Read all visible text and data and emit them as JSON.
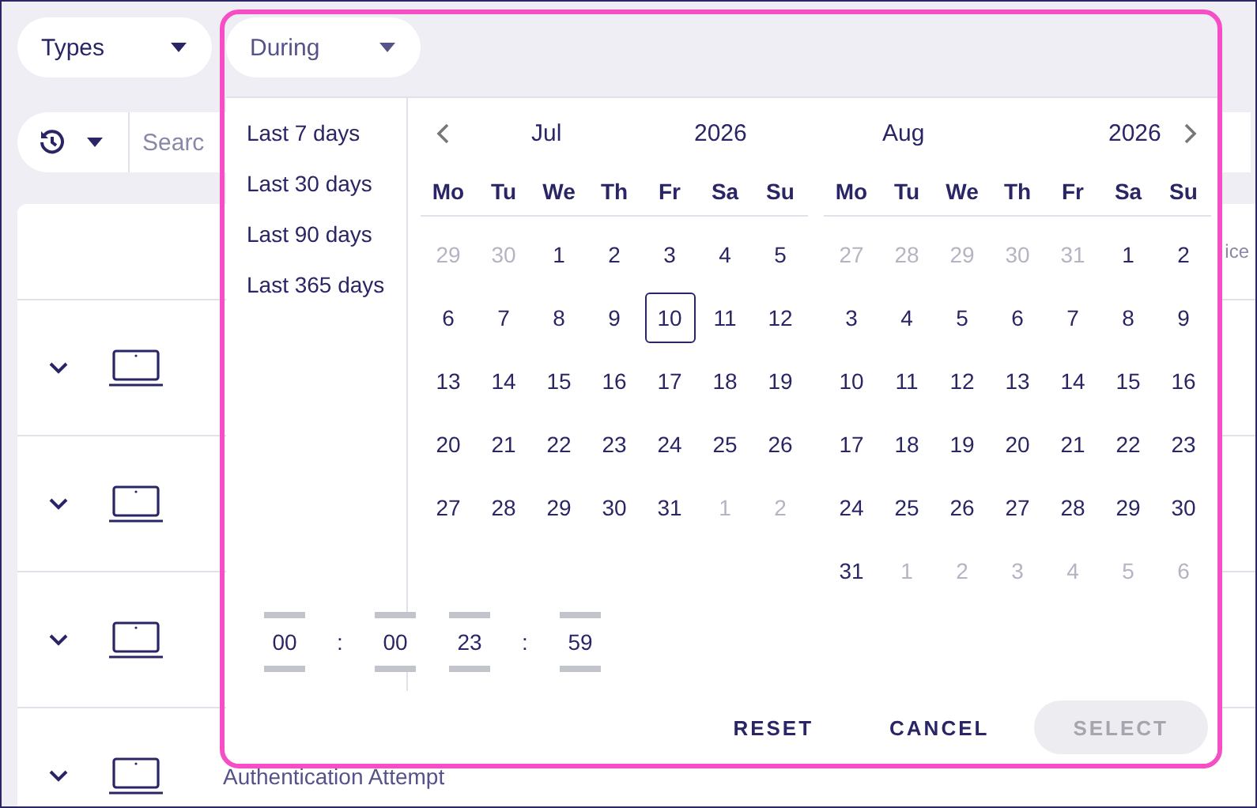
{
  "filters": [
    {
      "label": "Types"
    }
  ],
  "search": {
    "placeholder": "Searc"
  },
  "table": {
    "header": "ice",
    "rows": [
      {
        "expanded": false,
        "text": ""
      },
      {
        "expanded": false,
        "text": ""
      },
      {
        "expanded": false,
        "text": ""
      },
      {
        "expanded": false,
        "text": "Authentication Attempt"
      }
    ]
  },
  "picker": {
    "trigger": {
      "label": "During"
    },
    "presets": [
      "Last 7 days",
      "Last 30 days",
      "Last 90 days",
      "Last 365 days"
    ],
    "months": [
      {
        "month": "Jul",
        "year": "2026",
        "weekdays": [
          "Mo",
          "Tu",
          "We",
          "Th",
          "Fr",
          "Sa",
          "Su"
        ],
        "days": [
          {
            "label": "29",
            "outside": true,
            "selected": false
          },
          {
            "label": "30",
            "outside": true,
            "selected": false
          },
          {
            "label": "1",
            "outside": false,
            "selected": false
          },
          {
            "label": "2",
            "outside": false,
            "selected": false
          },
          {
            "label": "3",
            "outside": false,
            "selected": false
          },
          {
            "label": "4",
            "outside": false,
            "selected": false
          },
          {
            "label": "5",
            "outside": false,
            "selected": false
          },
          {
            "label": "6",
            "outside": false,
            "selected": false
          },
          {
            "label": "7",
            "outside": false,
            "selected": false
          },
          {
            "label": "8",
            "outside": false,
            "selected": false
          },
          {
            "label": "9",
            "outside": false,
            "selected": false
          },
          {
            "label": "10",
            "outside": false,
            "selected": true
          },
          {
            "label": "11",
            "outside": false,
            "selected": false
          },
          {
            "label": "12",
            "outside": false,
            "selected": false
          },
          {
            "label": "13",
            "outside": false,
            "selected": false
          },
          {
            "label": "14",
            "outside": false,
            "selected": false
          },
          {
            "label": "15",
            "outside": false,
            "selected": false
          },
          {
            "label": "16",
            "outside": false,
            "selected": false
          },
          {
            "label": "17",
            "outside": false,
            "selected": false
          },
          {
            "label": "18",
            "outside": false,
            "selected": false
          },
          {
            "label": "19",
            "outside": false,
            "selected": false
          },
          {
            "label": "20",
            "outside": false,
            "selected": false
          },
          {
            "label": "21",
            "outside": false,
            "selected": false
          },
          {
            "label": "22",
            "outside": false,
            "selected": false
          },
          {
            "label": "23",
            "outside": false,
            "selected": false
          },
          {
            "label": "24",
            "outside": false,
            "selected": false
          },
          {
            "label": "25",
            "outside": false,
            "selected": false
          },
          {
            "label": "26",
            "outside": false,
            "selected": false
          },
          {
            "label": "27",
            "outside": false,
            "selected": false
          },
          {
            "label": "28",
            "outside": false,
            "selected": false
          },
          {
            "label": "29",
            "outside": false,
            "selected": false
          },
          {
            "label": "30",
            "outside": false,
            "selected": false
          },
          {
            "label": "31",
            "outside": false,
            "selected": false
          },
          {
            "label": "1",
            "outside": true,
            "selected": false
          },
          {
            "label": "2",
            "outside": true,
            "selected": false
          }
        ]
      },
      {
        "month": "Aug",
        "year": "2026",
        "weekdays": [
          "Mo",
          "Tu",
          "We",
          "Th",
          "Fr",
          "Sa",
          "Su"
        ],
        "days": [
          {
            "label": "27",
            "outside": true,
            "selected": false
          },
          {
            "label": "28",
            "outside": true,
            "selected": false
          },
          {
            "label": "29",
            "outside": true,
            "selected": false
          },
          {
            "label": "30",
            "outside": true,
            "selected": false
          },
          {
            "label": "31",
            "outside": true,
            "selected": false
          },
          {
            "label": "1",
            "outside": false,
            "selected": false
          },
          {
            "label": "2",
            "outside": false,
            "selected": false
          },
          {
            "label": "3",
            "outside": false,
            "selected": false
          },
          {
            "label": "4",
            "outside": false,
            "selected": false
          },
          {
            "label": "5",
            "outside": false,
            "selected": false
          },
          {
            "label": "6",
            "outside": false,
            "selected": false
          },
          {
            "label": "7",
            "outside": false,
            "selected": false
          },
          {
            "label": "8",
            "outside": false,
            "selected": false
          },
          {
            "label": "9",
            "outside": false,
            "selected": false
          },
          {
            "label": "10",
            "outside": false,
            "selected": false
          },
          {
            "label": "11",
            "outside": false,
            "selected": false
          },
          {
            "label": "12",
            "outside": false,
            "selected": false
          },
          {
            "label": "13",
            "outside": false,
            "selected": false
          },
          {
            "label": "14",
            "outside": false,
            "selected": false
          },
          {
            "label": "15",
            "outside": false,
            "selected": false
          },
          {
            "label": "16",
            "outside": false,
            "selected": false
          },
          {
            "label": "17",
            "outside": false,
            "selected": false
          },
          {
            "label": "18",
            "outside": false,
            "selected": false
          },
          {
            "label": "19",
            "outside": false,
            "selected": false
          },
          {
            "label": "20",
            "outside": false,
            "selected": false
          },
          {
            "label": "21",
            "outside": false,
            "selected": false
          },
          {
            "label": "22",
            "outside": false,
            "selected": false
          },
          {
            "label": "23",
            "outside": false,
            "selected": false
          },
          {
            "label": "24",
            "outside": false,
            "selected": false
          },
          {
            "label": "25",
            "outside": false,
            "selected": false
          },
          {
            "label": "26",
            "outside": false,
            "selected": false
          },
          {
            "label": "27",
            "outside": false,
            "selected": false
          },
          {
            "label": "28",
            "outside": false,
            "selected": false
          },
          {
            "label": "29",
            "outside": false,
            "selected": false
          },
          {
            "label": "30",
            "outside": false,
            "selected": false
          },
          {
            "label": "31",
            "outside": false,
            "selected": false
          },
          {
            "label": "1",
            "outside": true,
            "selected": false
          },
          {
            "label": "2",
            "outside": true,
            "selected": false
          },
          {
            "label": "3",
            "outside": true,
            "selected": false
          },
          {
            "label": "4",
            "outside": true,
            "selected": false
          },
          {
            "label": "5",
            "outside": true,
            "selected": false
          },
          {
            "label": "6",
            "outside": true,
            "selected": false
          }
        ]
      }
    ],
    "times": [
      {
        "hours": "00",
        "minutes": "00",
        "separator": ":"
      },
      {
        "hours": "23",
        "minutes": "59",
        "separator": ":"
      }
    ],
    "buttons": [
      {
        "label": "RESET",
        "disabled": false
      },
      {
        "label": "CANCEL",
        "disabled": false
      },
      {
        "label": "SELECT",
        "disabled": true
      }
    ]
  }
}
